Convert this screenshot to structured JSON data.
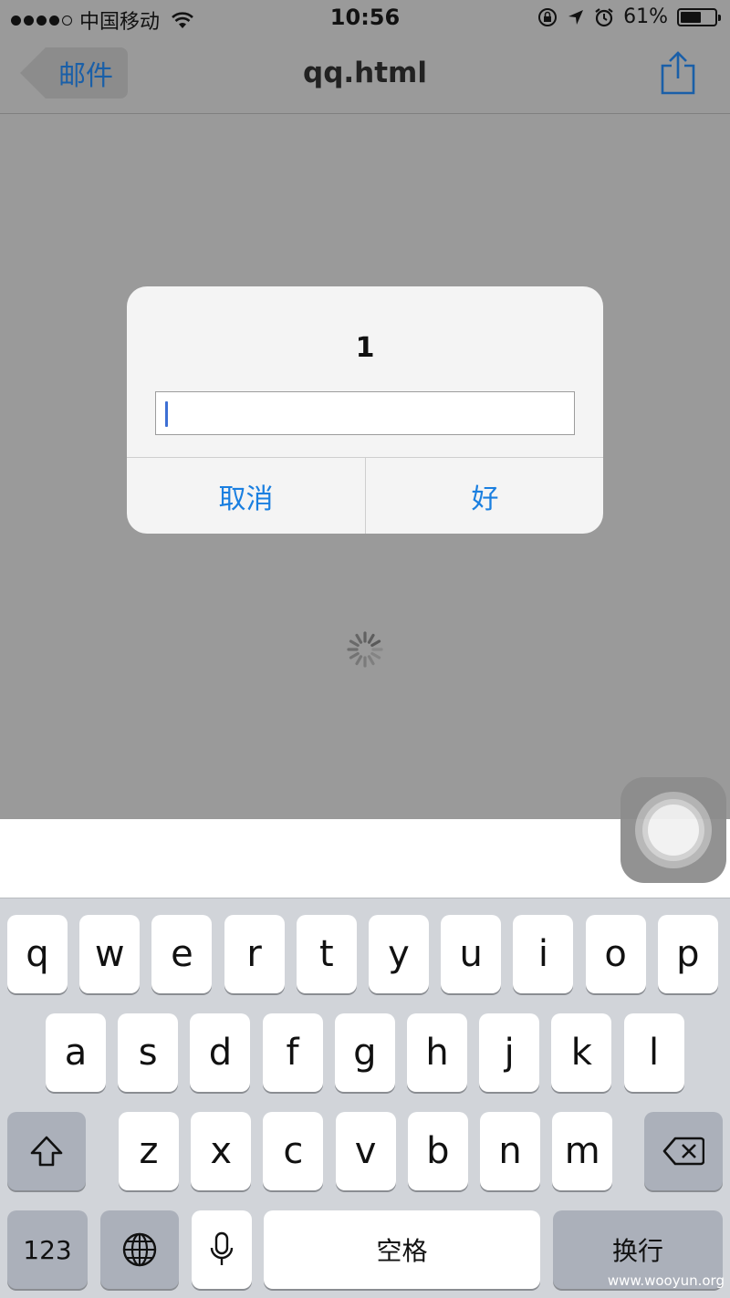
{
  "status": {
    "carrier": "中国移动",
    "time": "10:56",
    "battery_percent": "61%",
    "battery_level": 0.61
  },
  "nav": {
    "back_label": "邮件",
    "title": "qq.html"
  },
  "alert": {
    "title": "1",
    "input_value": "",
    "cancel_label": "取消",
    "ok_label": "好"
  },
  "keyboard": {
    "row1": [
      "q",
      "w",
      "e",
      "r",
      "t",
      "y",
      "u",
      "i",
      "o",
      "p"
    ],
    "row2": [
      "a",
      "s",
      "d",
      "f",
      "g",
      "h",
      "j",
      "k",
      "l"
    ],
    "row3": [
      "z",
      "x",
      "c",
      "v",
      "b",
      "n",
      "m"
    ],
    "numbers_label": "123",
    "space_label": "空格",
    "return_label": "换行"
  },
  "watermark": "www.wooyun.org",
  "colors": {
    "accent": "#1a7fe0",
    "back_text": "#1a5fa8",
    "dim_background": "#9a9a9a",
    "keyboard_background": "#d1d4d9"
  }
}
